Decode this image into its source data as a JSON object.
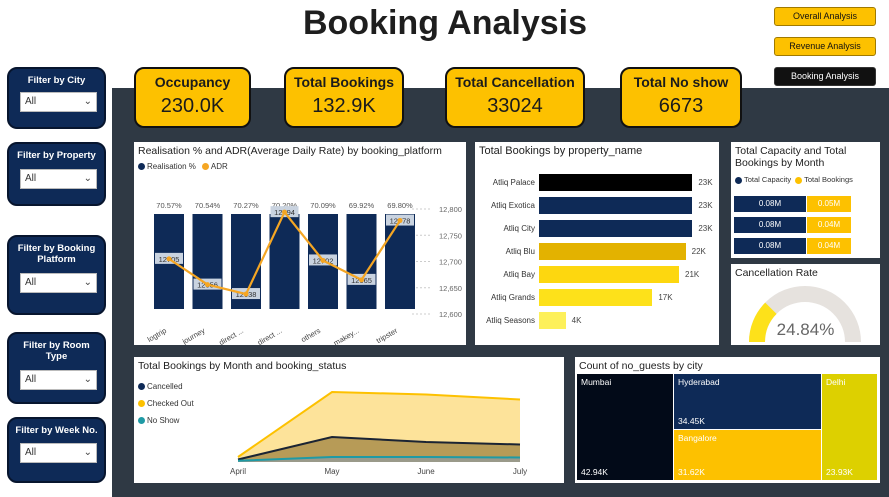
{
  "title": "Booking Analysis",
  "nav": [
    {
      "label": "Overall Analysis",
      "style": "y"
    },
    {
      "label": "Revenue Analysis",
      "style": "y"
    },
    {
      "label": "Booking Analysis",
      "style": "k"
    }
  ],
  "kpis": [
    {
      "label": "Occupancy",
      "value": "230.0K"
    },
    {
      "label": "Total Bookings",
      "value": "132.9K"
    },
    {
      "label": "Total Cancellation",
      "value": "33024"
    },
    {
      "label": "Total No show",
      "value": "6673"
    }
  ],
  "filters": [
    {
      "label": "Filter by City",
      "value": "All"
    },
    {
      "label": "Filter by Property",
      "value": "All"
    },
    {
      "label": "Filter by Booking Platform",
      "value": "All"
    },
    {
      "label": "Filter by Room Type",
      "value": "All"
    },
    {
      "label": "Filter by Week No.",
      "value": "All"
    }
  ],
  "platform_chart": {
    "title": "Realisation % and ADR(Average Daily Rate) by booking_platform",
    "legend": [
      "Realisation %",
      "ADR"
    ],
    "y2_ticks": [
      "12,800",
      "12,750",
      "12,700",
      "12,650",
      "12,600"
    ]
  },
  "property_chart": {
    "title": "Total Bookings by property_name"
  },
  "capacity_chart": {
    "title": "Total Capacity and Total Bookings by Month",
    "legend": [
      "Total Capacity",
      "Total Bookings"
    ],
    "rows": [
      {
        "cap": "0.08M",
        "book": "0.05M"
      },
      {
        "cap": "0.08M",
        "book": "0.04M"
      },
      {
        "cap": "0.08M",
        "book": "0.04M"
      }
    ]
  },
  "cancellation_rate": {
    "title": "Cancellation Rate",
    "value": "24.84%",
    "fraction": 0.2484
  },
  "status_chart": {
    "title": "Total Bookings by Month and booking_status",
    "legend": [
      "Cancelled",
      "Checked Out",
      "No Show"
    ]
  },
  "guests_chart": {
    "title": "Count of no_guests by city",
    "cells": [
      {
        "city": "Mumbai",
        "value": "42.94K"
      },
      {
        "city": "Hyderabad",
        "value": "34.45K"
      },
      {
        "city": "Bangalore",
        "value": "31.62K"
      },
      {
        "city": "Delhi",
        "value": "23.93K"
      }
    ]
  },
  "colors": {
    "navy": "#0e2a57",
    "yellow": "#fdc100",
    "orange": "#f5a623",
    "dark": "#2f3944",
    "teal": "#1f9aa5"
  },
  "chart_data": [
    {
      "type": "bar",
      "title": "Realisation % and ADR(Average Daily Rate) by booking_platform",
      "categories": [
        "logtrip",
        "journey",
        "direct ...",
        "direct ...",
        "others",
        "makey...",
        "tripster"
      ],
      "series": [
        {
          "name": "Realisation %",
          "values": [
            70.57,
            70.54,
            70.27,
            70.2,
            70.09,
            69.92,
            69.8
          ],
          "labels": [
            "70.57%",
            "70.54%",
            "70.27%",
            "70.20%",
            "70.09%",
            "69.92%",
            "69.80%"
          ]
        },
        {
          "name": "ADR",
          "type": "line",
          "values": [
            12705,
            12656,
            12638,
            12794,
            12702,
            12665,
            12778
          ]
        }
      ],
      "y2lim": [
        12600,
        12800
      ]
    },
    {
      "type": "bar",
      "title": "Total Bookings by property_name",
      "categories": [
        "Atliq Palace",
        "Atliq Exotica",
        "Atliq City",
        "Atliq Blu",
        "Atliq Bay",
        "Atliq Grands",
        "Atliq Seasons"
      ],
      "values": [
        23,
        23,
        23,
        22,
        21,
        17,
        4
      ],
      "labels": [
        "23K",
        "23K",
        "23K",
        "22K",
        "21K",
        "17K",
        "4K"
      ]
    },
    {
      "type": "bar",
      "title": "Total Capacity and Total Bookings by Month",
      "series": [
        {
          "name": "Total Capacity",
          "values": [
            0.08,
            0.08,
            0.08
          ]
        },
        {
          "name": "Total Bookings",
          "values": [
            0.05,
            0.04,
            0.04
          ]
        }
      ]
    },
    {
      "type": "area",
      "title": "Total Bookings by Month and booking_status",
      "categories": [
        "April",
        "May",
        "June",
        "July"
      ],
      "series": [
        {
          "name": "Checked Out",
          "values": [
            2,
            28,
            27,
            25
          ]
        },
        {
          "name": "Cancelled",
          "values": [
            1,
            10,
            8,
            7
          ]
        },
        {
          "name": "No Show",
          "values": [
            0.5,
            2,
            2,
            1.8
          ]
        }
      ]
    }
  ]
}
